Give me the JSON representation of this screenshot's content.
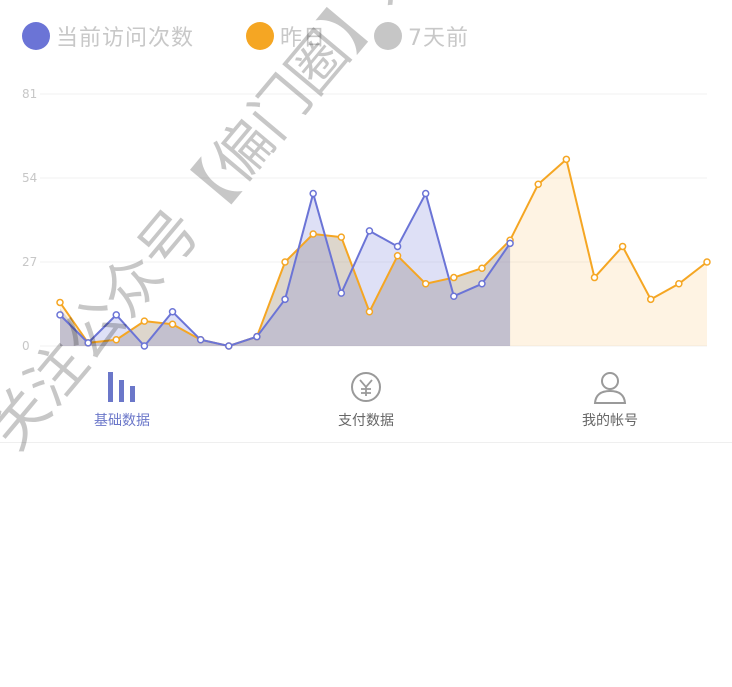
{
  "legend": [
    {
      "label": "当前访问次数",
      "color": "#6b74d6"
    },
    {
      "label": "昨日",
      "color": "#f5a623"
    },
    {
      "label": "7天前",
      "color": "#c6c6c6"
    }
  ],
  "chart_data": {
    "type": "area",
    "y_ticks": [
      "81",
      "54",
      "27",
      "0"
    ],
    "ylim": [
      0,
      81
    ],
    "grid": true,
    "x": [
      0,
      1,
      2,
      3,
      4,
      5,
      6,
      7,
      8,
      9,
      10,
      11,
      12,
      13,
      14,
      15,
      16,
      17,
      18,
      19,
      20,
      21,
      22,
      23
    ],
    "series": [
      {
        "name": "当前访问次数",
        "color": "#6b74d6",
        "values": [
          10,
          1,
          10,
          0,
          11,
          2,
          0,
          3,
          15,
          49,
          17,
          37,
          32,
          49,
          16,
          20,
          33
        ]
      },
      {
        "name": "昨日",
        "color": "#f5a623",
        "values": [
          14,
          1,
          2,
          8,
          7,
          2,
          0,
          3,
          27,
          36,
          35,
          11,
          29,
          20,
          22,
          25,
          34,
          52,
          60,
          22,
          32,
          15,
          20,
          27
        ]
      },
      {
        "name": "7天前",
        "color": "#c6c6c6",
        "values": [
          12,
          1,
          2,
          8,
          7,
          2,
          0,
          3,
          27,
          36,
          35,
          11,
          29,
          20,
          22,
          25,
          34
        ]
      }
    ]
  },
  "tabs": [
    {
      "label": "基础数据",
      "icon": "bar-chart-icon",
      "active": true
    },
    {
      "label": "支付数据",
      "icon": "yuan-coin-icon",
      "active": false
    },
    {
      "label": "我的帐号",
      "icon": "user-icon",
      "active": false
    }
  ],
  "watermark": {
    "text": "关注公众号【偏门圈】发送：力"
  }
}
